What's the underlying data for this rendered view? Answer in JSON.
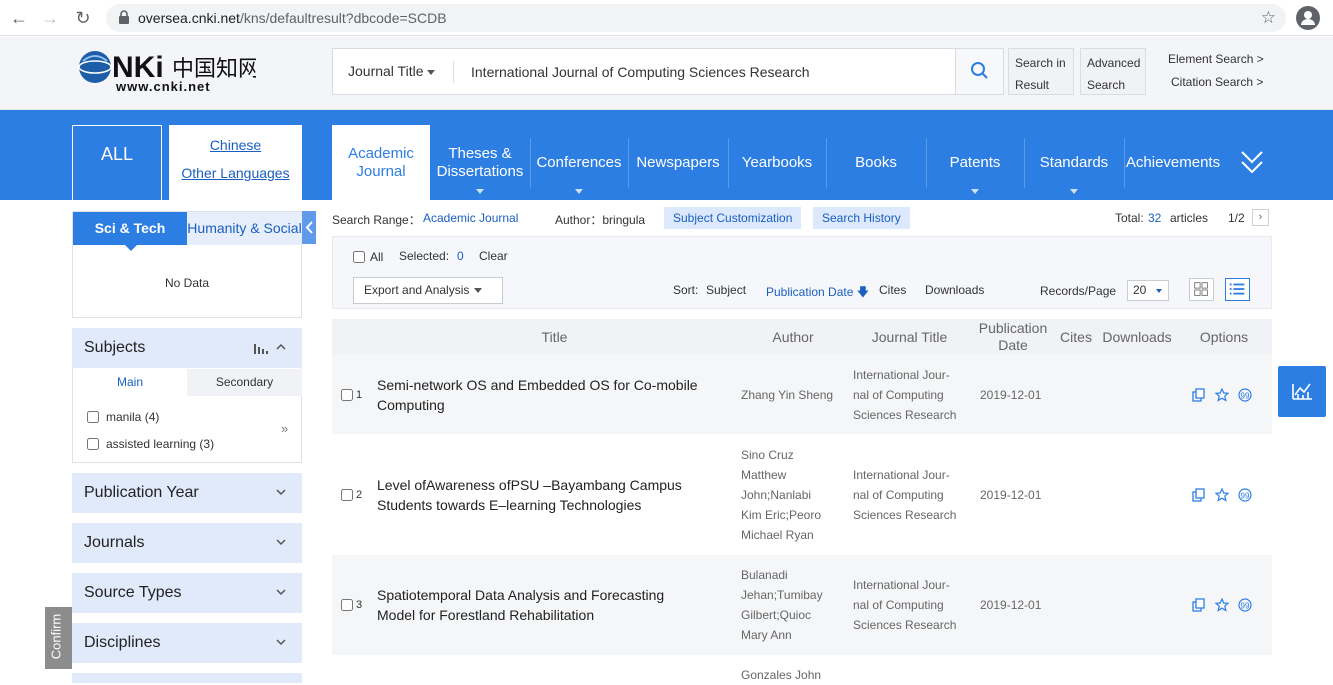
{
  "browser": {
    "url_host": "oversea.cnki.net",
    "url_path": "/kns/defaultresult?dbcode=SCDB"
  },
  "header": {
    "field": "Journal Title",
    "query": "International Journal of Computing Sciences Research",
    "search_in_result": [
      "Search in",
      "Result"
    ],
    "advanced_search": [
      "Advanced",
      "Search"
    ],
    "element_search": "Element Search  >",
    "citation_search": "Citation Search  >"
  },
  "nav": {
    "all": "ALL",
    "chinese": "Chinese",
    "other_languages": "Other Languages",
    "tabs": [
      {
        "line1": "Academic",
        "line2": "Journal"
      },
      {
        "line1": "Theses &",
        "line2": "Dissertations"
      },
      {
        "line1": "Conferences",
        "line2": ""
      },
      {
        "line1": "Newspapers",
        "line2": ""
      },
      {
        "line1": "Yearbooks",
        "line2": ""
      },
      {
        "line1": "Books",
        "line2": ""
      },
      {
        "line1": "Patents",
        "line2": ""
      },
      {
        "line1": "Standards",
        "line2": ""
      },
      {
        "line1": "Achievements",
        "line2": ""
      }
    ]
  },
  "sidebar": {
    "sci_tech": "Sci & Tech",
    "humanity": "Humanity & Social",
    "no_data": "No Data",
    "subjects": {
      "title": "Subjects",
      "tab_main": "Main",
      "tab_secondary": "Secondary",
      "items": [
        {
          "label": "manila",
          "count": "(4)"
        },
        {
          "label": "assisted learning",
          "count": "(3)"
        }
      ]
    },
    "facets": [
      "Publication Year",
      "Journals",
      "Source Types",
      "Disciplines"
    ],
    "confirm": "Confirm"
  },
  "results": {
    "range_label": "Search Range：",
    "range_value": "Academic Journal",
    "author_label": "Author：bringula",
    "subject_customization": "Subject Customization",
    "search_history": "Search History",
    "total_label": "Total:",
    "total": "32",
    "articles": "articles",
    "page": "1/2",
    "all": "All",
    "selected_label": "Selected:",
    "selected": "0",
    "clear": "Clear",
    "export": "Export and Analysis",
    "sort_label": "Sort:",
    "sort_subject": "Subject",
    "sort_pubdate": "Publication Date",
    "sort_cites": "Cites",
    "sort_downloads": "Downloads",
    "rpp_label": "Records/Page",
    "rpp": "20",
    "columns": {
      "title": "Title",
      "author": "Author",
      "journal": "Journal Title",
      "pubdate1": "Publication",
      "pubdate2": "Date",
      "cites": "Cites",
      "downloads": "Downloads",
      "options": "Options"
    },
    "rows": [
      {
        "num": "1",
        "title": [
          "Semi-network OS and Embedded OS for Co-mobile",
          "Computing"
        ],
        "author": [
          "Zhang Yin Sheng"
        ],
        "journal": [
          "International Jour-",
          "nal of Computing",
          "Sciences Research"
        ],
        "date": "2019-12-01"
      },
      {
        "num": "2",
        "title": [
          "Level ofAwareness ofPSU –Bayambang Campus",
          "Students towards E–learning Technologies"
        ],
        "author": [
          "Sino Cruz",
          "Matthew",
          "John;Nanlabi",
          "Kim Eric;Peoro",
          "Michael Ryan"
        ],
        "journal": [
          "International Jour-",
          "nal of Computing",
          "Sciences Research"
        ],
        "date": "2019-12-01"
      },
      {
        "num": "3",
        "title": [
          "Spatiotemporal Data Analysis and Forecasting",
          "Model for Forestland Rehabilitation"
        ],
        "author": [
          "Bulanadi",
          "Jehan;Tumibay",
          "Gilbert;Quioc",
          "Mary Ann"
        ],
        "journal": [
          "International Jour-",
          "nal of Computing",
          "Sciences Research"
        ],
        "date": "2019-12-01"
      },
      {
        "num": "",
        "title": [],
        "author": [
          "Gonzales John"
        ],
        "journal": [],
        "date": ""
      }
    ]
  }
}
